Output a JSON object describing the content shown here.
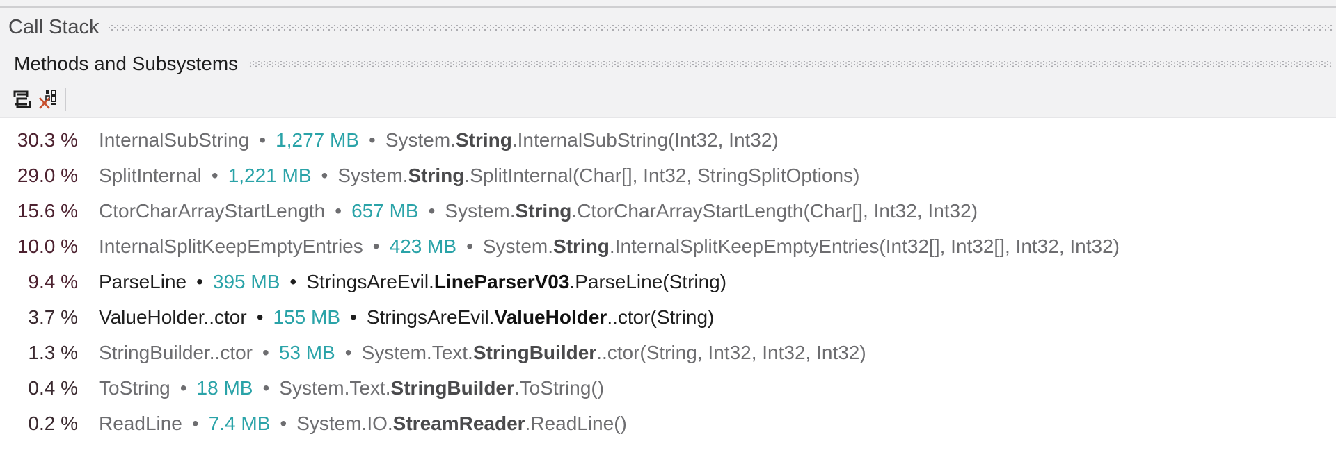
{
  "panels": {
    "call_stack_title": "Call Stack",
    "methods_title": "Methods and Subsystems"
  },
  "toolbar": {
    "buttons": [
      {
        "icon": "toggle-view-icon",
        "label": "Toggle view"
      },
      {
        "icon": "clear-filter-icon",
        "label": "Clear filter"
      }
    ]
  },
  "colors": {
    "size_accent": "#2aa3a8",
    "percent_text": "#3b2a30",
    "system_text": "#6d6d70",
    "user_text": "#1e1e1e"
  },
  "rows": [
    {
      "percent": "30.3 %",
      "name": "InternalSubString",
      "size": "1,277 MB",
      "ns": "System.",
      "cls": "String",
      "member": ".InternalSubString(Int32, Int32)",
      "user": false
    },
    {
      "percent": "29.0 %",
      "name": "SplitInternal",
      "size": "1,221 MB",
      "ns": "System.",
      "cls": "String",
      "member": ".SplitInternal(Char[], Int32, StringSplitOptions)",
      "user": false
    },
    {
      "percent": "15.6 %",
      "name": "CtorCharArrayStartLength",
      "size": "657 MB",
      "ns": "System.",
      "cls": "String",
      "member": ".CtorCharArrayStartLength(Char[], Int32, Int32)",
      "user": false
    },
    {
      "percent": "10.0 %",
      "name": "InternalSplitKeepEmptyEntries",
      "size": "423 MB",
      "ns": "System.",
      "cls": "String",
      "member": ".InternalSplitKeepEmptyEntries(Int32[], Int32[], Int32, Int32)",
      "user": false
    },
    {
      "percent": "9.4 %",
      "name": "ParseLine",
      "size": "395 MB",
      "ns": "StringsAreEvil.",
      "cls": "LineParserV03",
      "member": ".ParseLine(String)",
      "user": true
    },
    {
      "percent": "3.7 %",
      "name": "ValueHolder..ctor",
      "size": "155 MB",
      "ns": "StringsAreEvil.",
      "cls": "ValueHolder",
      "member": "..ctor(String)",
      "user": true
    },
    {
      "percent": "1.3 %",
      "name": "StringBuilder..ctor",
      "size": "53 MB",
      "ns": "System.Text.",
      "cls": "StringBuilder",
      "member": "..ctor(String, Int32, Int32, Int32)",
      "user": false
    },
    {
      "percent": "0.4 %",
      "name": "ToString",
      "size": "18 MB",
      "ns": "System.Text.",
      "cls": "StringBuilder",
      "member": ".ToString()",
      "user": false
    },
    {
      "percent": "0.2 %",
      "name": "ReadLine",
      "size": "7.4 MB",
      "ns": "System.IO.",
      "cls": "StreamReader",
      "member": ".ReadLine()",
      "user": false
    }
  ],
  "separator_glyph": "•"
}
